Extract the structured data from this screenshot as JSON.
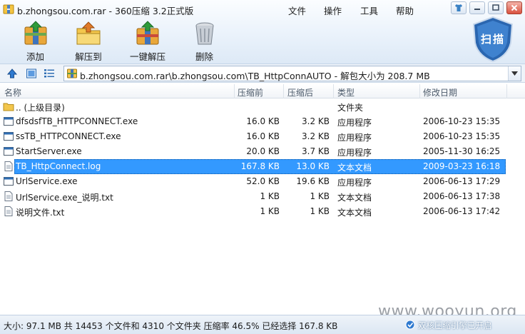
{
  "window": {
    "title": "b.zhongsou.com.rar - 360压缩 3.2正式版"
  },
  "menu": [
    {
      "label": "文件"
    },
    {
      "label": "操作"
    },
    {
      "label": "工具"
    },
    {
      "label": "帮助"
    }
  ],
  "toolbar": {
    "add_label": "添加",
    "extract_label": "解压到",
    "oneclick_label": "一键解压",
    "delete_label": "删除",
    "scan_label": "扫描"
  },
  "address": {
    "path": "b.zhongsou.com.rar\\b.zhongsou.com\\TB_HttpConnAUTO - 解包大小为 208.7 MB"
  },
  "columns": {
    "name": "名称",
    "packed": "压缩前",
    "size": "压缩后",
    "type": "类型",
    "modified": "修改日期"
  },
  "files": [
    {
      "name": ".. (上级目录)",
      "packed": "",
      "size": "",
      "type": "文件夹",
      "modified": "",
      "icon": "folder-icon"
    },
    {
      "name": "dfsdsfTB_HTTPCONNECT.exe",
      "packed": "16.0 KB",
      "size": "3.2 KB",
      "type": "应用程序",
      "modified": "2006-10-23 15:35",
      "icon": "exe-icon"
    },
    {
      "name": "ssTB_HTTPCONNECT.exe",
      "packed": "16.0 KB",
      "size": "3.2 KB",
      "type": "应用程序",
      "modified": "2006-10-23 15:35",
      "icon": "exe-icon"
    },
    {
      "name": "StartServer.exe",
      "packed": "20.0 KB",
      "size": "3.7 KB",
      "type": "应用程序",
      "modified": "2005-11-30 16:25",
      "icon": "exe-icon"
    },
    {
      "name": "TB_HttpConnect.log",
      "packed": "167.8 KB",
      "size": "13.0 KB",
      "type": "文本文档",
      "modified": "2009-03-23 16:18",
      "icon": "text-file-icon",
      "selected": true
    },
    {
      "name": "UrlService.exe",
      "packed": "52.0 KB",
      "size": "19.6 KB",
      "type": "应用程序",
      "modified": "2006-06-13 17:29",
      "icon": "exe-icon"
    },
    {
      "name": "UrlService.exe_说明.txt",
      "packed": "1 KB",
      "size": "1 KB",
      "type": "文本文档",
      "modified": "2006-06-13 17:38",
      "icon": "text-file-icon"
    },
    {
      "name": "说明文件.txt",
      "packed": "1 KB",
      "size": "1 KB",
      "type": "文本文档",
      "modified": "2006-06-13 17:42",
      "icon": "text-file-icon"
    }
  ],
  "status": {
    "text": "大小: 97.1 MB 共 14453 个文件和 4310 个文件夹 压缩率 46.5% 已经选择 167.8 KB",
    "engine": "双核压缩引擎已开启"
  },
  "watermark": "www.wooyun.org",
  "colors": {
    "selection": "#3399ff",
    "accent": "#2f6db3",
    "scan_badge": "#2a66b0"
  }
}
